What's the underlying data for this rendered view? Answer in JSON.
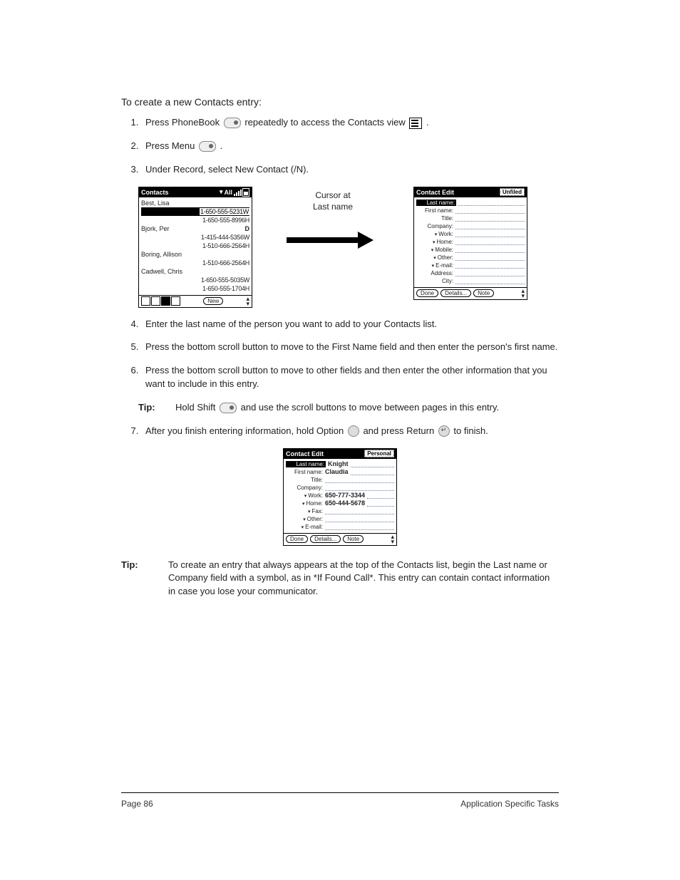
{
  "heading": "To create a new Contacts entry:",
  "steps": {
    "s1a": "Press PhoneBook ",
    "s1b": " repeatedly to access the Contacts view ",
    "s1c": ".",
    "s2a": "Press Menu ",
    "s2b": ".",
    "s3": "Under Record, select New Contact (/N).",
    "s4": "Enter the last name of the person you want to add to your Contacts list.",
    "s5": "Press the bottom scroll button to move to the First Name field and then enter the person's first name.",
    "s6": "Press the bottom scroll button to move to other fields and then enter the other information that you want to include in this entry.",
    "s7a": "After you finish entering information, hold Option ",
    "s7b": " and press Return ",
    "s7c": " to finish."
  },
  "tip1": {
    "label": "Tip:",
    "a": "Hold Shift ",
    "b": " and use the scroll buttons to move between pages in this entry."
  },
  "tip2": {
    "label": "Tip:",
    "text": "To create an entry that always appears at the top of the Contacts list, begin the Last name or Company field with a symbol, as in *If Found Call*. This entry can contain contact information in case you lose your communicator."
  },
  "callout": {
    "line1": "Cursor at",
    "line2": "Last name"
  },
  "pda1": {
    "title": "Contacts",
    "category": "All",
    "rows": [
      {
        "name": "Best, Lisa",
        "num": ""
      },
      {
        "name": "",
        "num": "1-650-555-5231W"
      },
      {
        "name": "",
        "num": "1-650-555-8996H"
      },
      {
        "name": "Bjork, Per",
        "num": "D"
      },
      {
        "name": "",
        "num": "1-415-444-5356W"
      },
      {
        "name": "",
        "num": "1-510-666-2564H"
      },
      {
        "name": "Boring, Allison",
        "num": ""
      },
      {
        "name": "",
        "num": "1-510-666-2564H"
      },
      {
        "name": "Cadwell, Chris",
        "num": ""
      },
      {
        "name": "",
        "num": "1-650-555-5035W"
      },
      {
        "name": "",
        "num": "1-650-555-1704H"
      }
    ],
    "new_btn": "New"
  },
  "pda2": {
    "title": "Contact Edit",
    "category": "Unfiled",
    "fields": [
      {
        "lbl": "Last name:",
        "drop": false,
        "hl": true
      },
      {
        "lbl": "First name:",
        "drop": false
      },
      {
        "lbl": "Title:",
        "drop": false
      },
      {
        "lbl": "Company:",
        "drop": false
      },
      {
        "lbl": "Work:",
        "drop": true
      },
      {
        "lbl": "Home:",
        "drop": true
      },
      {
        "lbl": "Mobile:",
        "drop": true
      },
      {
        "lbl": "Other:",
        "drop": true
      },
      {
        "lbl": "E-mail:",
        "drop": true
      },
      {
        "lbl": "Address:",
        "drop": false
      },
      {
        "lbl": "City:",
        "drop": false
      }
    ],
    "done": "Done",
    "details": "Details...",
    "note": "Note"
  },
  "pda3": {
    "title": "Contact Edit",
    "category": "Personal",
    "fields": [
      {
        "lbl": "Last name:",
        "drop": false,
        "hl": true,
        "val": "Knight"
      },
      {
        "lbl": "First name:",
        "drop": false,
        "val": "Claudia"
      },
      {
        "lbl": "Title:",
        "drop": false
      },
      {
        "lbl": "Company:",
        "drop": false
      },
      {
        "lbl": "Work:",
        "drop": true,
        "val": "650-777-3344"
      },
      {
        "lbl": "Home:",
        "drop": true,
        "val": "650-444-5678"
      },
      {
        "lbl": "Fax:",
        "drop": true
      },
      {
        "lbl": "Other:",
        "drop": true
      },
      {
        "lbl": "E-mail:",
        "drop": true
      }
    ],
    "done": "Done",
    "details": "Details...",
    "note": "Note"
  },
  "footer": {
    "page": "Page 86",
    "section": "Application Specific Tasks"
  }
}
